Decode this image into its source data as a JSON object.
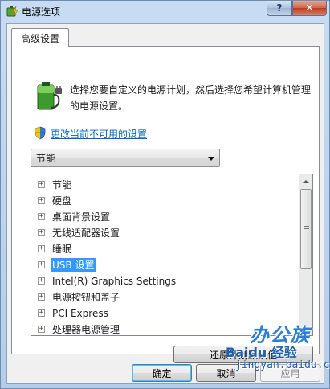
{
  "window": {
    "title": "电源选项",
    "help_glyph": "?",
    "close_glyph": "✕"
  },
  "tab": {
    "label": "高级设置"
  },
  "description": "选择您要自定义的电源计划，然后选择您希望计算机管理的电源设置。",
  "change_link": "更改当前不可用的设置",
  "plan_select": {
    "selected": "节能"
  },
  "tree": {
    "expander_glyph": "+",
    "items": [
      {
        "label": "节能"
      },
      {
        "label": "硬盘"
      },
      {
        "label": "桌面背景设置"
      },
      {
        "label": "无线适配器设置"
      },
      {
        "label": "睡眠"
      },
      {
        "label": "USB 设置"
      },
      {
        "label": "Intel(R) Graphics Settings"
      },
      {
        "label": "电源按钮和盖子"
      },
      {
        "label": "PCI Express"
      },
      {
        "label": "处理器电源管理"
      }
    ],
    "selected_index": 5
  },
  "buttons": {
    "restore": "还原计划默认值",
    "ok": "确定",
    "cancel": "取消",
    "apply": "应用"
  },
  "watermark": {
    "line1": "办公族",
    "line2": "Baidu 经验",
    "line3": "jingyan.baidu.com"
  },
  "colors": {
    "link": "#0066cc",
    "selection": "#3399ff"
  }
}
